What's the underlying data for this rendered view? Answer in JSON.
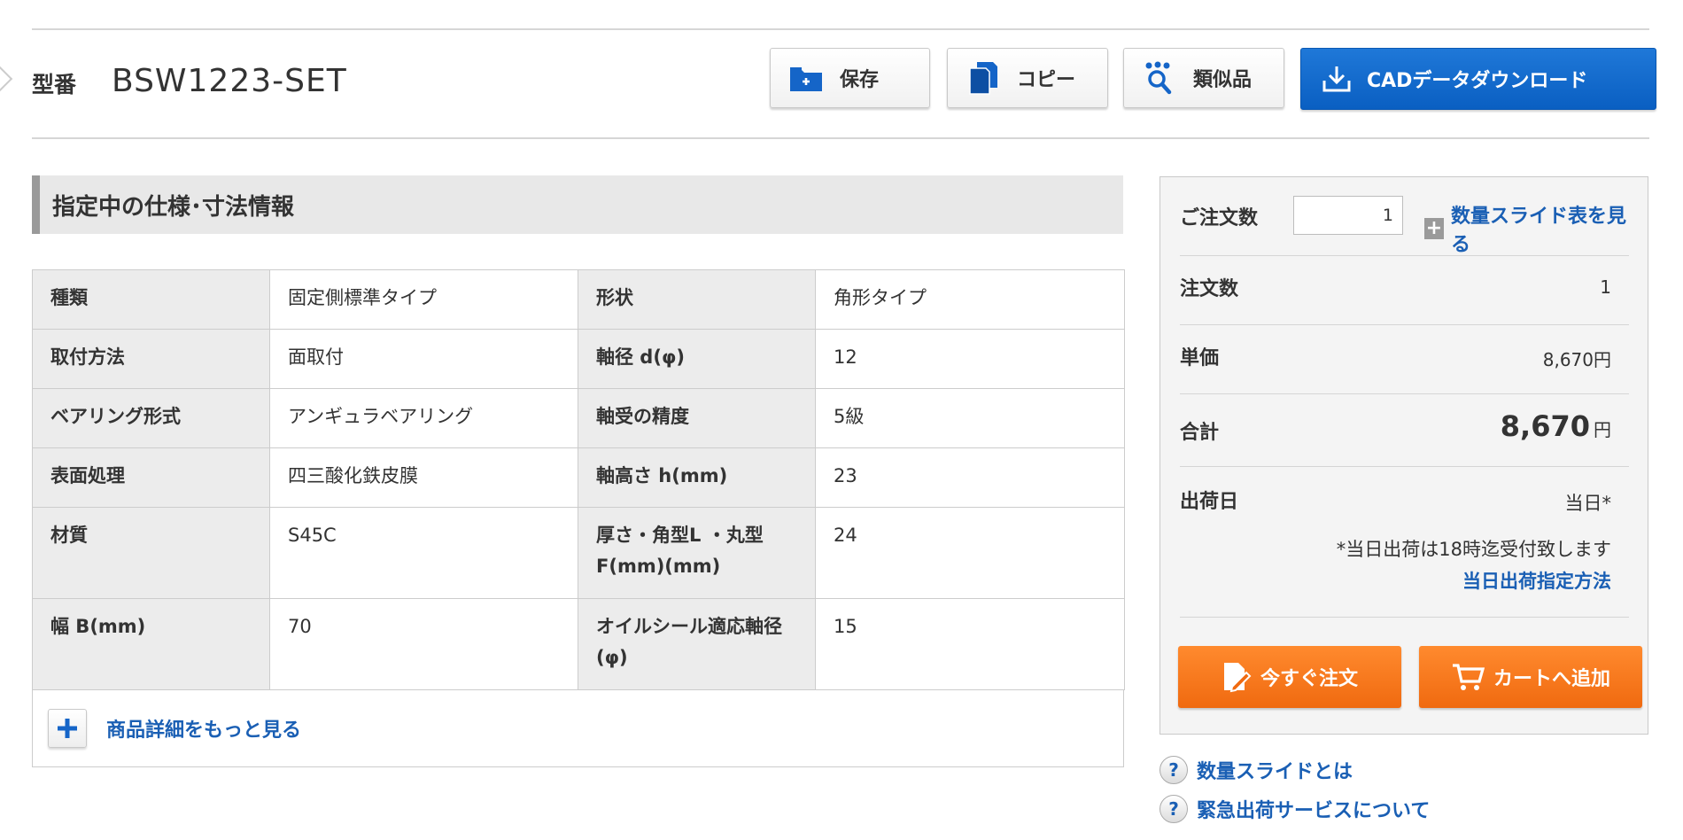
{
  "header": {
    "model_label": "型番",
    "model_number": "BSW1223-SET",
    "buttons": {
      "save": "保存",
      "copy": "コピー",
      "similar": "類似品",
      "cad": "CADデータダウンロード"
    }
  },
  "spec": {
    "heading": "指定中の仕様･寸法情報",
    "rows": [
      [
        {
          "k": "種類",
          "v": "固定側標準タイプ"
        },
        {
          "k": "形状",
          "v": "角形タイプ"
        }
      ],
      [
        {
          "k": "取付方法",
          "v": "面取付"
        },
        {
          "k": "軸径 d(φ)",
          "v": "12"
        }
      ],
      [
        {
          "k": "ベアリング形式",
          "v": "アンギュラベアリング"
        },
        {
          "k": "軸受の精度",
          "v": "5級"
        }
      ],
      [
        {
          "k": "表面処理",
          "v": "四三酸化鉄皮膜"
        },
        {
          "k": "軸高さ h(mm)",
          "v": "23"
        }
      ],
      [
        {
          "k": "材質",
          "v": "S45C"
        },
        {
          "k": "厚さ・角型L ・丸型F(mm)(mm)",
          "v": "24"
        }
      ],
      [
        {
          "k": "幅 B(mm)",
          "v": "70"
        },
        {
          "k": "オイルシール適応軸径(φ)",
          "v": "15"
        }
      ]
    ],
    "more_link": "商品詳細をもっと見る"
  },
  "order": {
    "qty_label": "ご注文数",
    "qty_value": "1",
    "slide_link": "数量スライド表を見る",
    "order_count_label": "注文数",
    "order_count_value": "1",
    "unit_price_label": "単価",
    "unit_price_value": "8,670円",
    "total_label": "合計",
    "total_value": "8,670",
    "total_unit": "円",
    "ship_label": "出荷日",
    "ship_value": "当日*",
    "ship_note": "*当日出荷は18時迄受付致します",
    "ship_link": "当日出荷指定方法",
    "order_now": "今すぐ注文",
    "add_cart": "カートへ追加"
  },
  "help": {
    "slide": "数量スライドとは",
    "express": "緊急出荷サービスについて"
  },
  "colors": {
    "accent_blue": "#0a5fc2",
    "link_blue": "#1a5fb4",
    "order_orange": "#f06a10"
  }
}
